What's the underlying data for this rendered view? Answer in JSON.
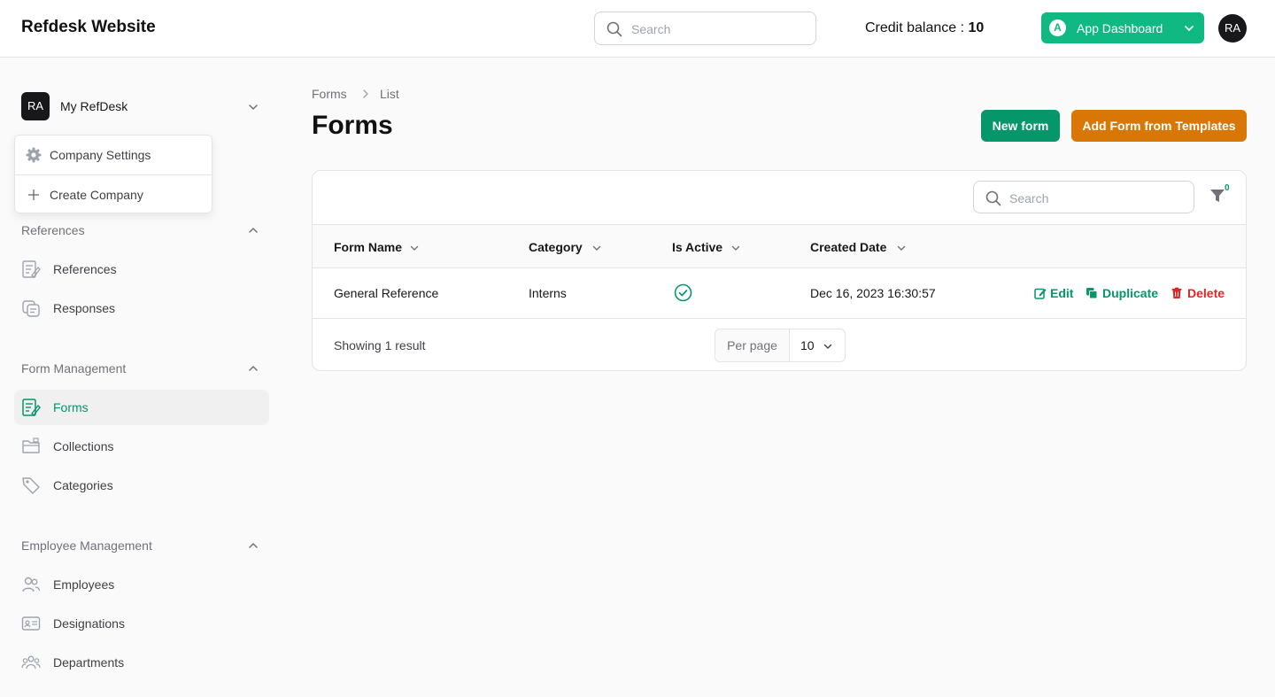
{
  "app": {
    "title": "Refdesk Website"
  },
  "topbar": {
    "search_placeholder": "Search",
    "credit_label": "Credit balance : ",
    "credit_value": "10",
    "app_dashboard": {
      "badge": "A",
      "label": "App Dashboard"
    },
    "user_initials": "RA"
  },
  "sidebar": {
    "company": {
      "initials": "RA",
      "name": "My RefDesk"
    },
    "company_menu": [
      {
        "label": "Company Settings",
        "icon": "gear-icon"
      },
      {
        "label": "Create Company",
        "icon": "plus-icon"
      }
    ],
    "groups": [
      {
        "title": "References",
        "items": [
          {
            "label": "References",
            "icon": "document-pen-icon"
          },
          {
            "label": "Responses",
            "icon": "responses-icon"
          }
        ]
      },
      {
        "title": "Form Management",
        "items": [
          {
            "label": "Forms",
            "icon": "document-pen-icon",
            "active": true
          },
          {
            "label": "Collections",
            "icon": "folder-icon"
          },
          {
            "label": "Categories",
            "icon": "tag-icon"
          }
        ]
      },
      {
        "title": "Employee Management",
        "items": [
          {
            "label": "Employees",
            "icon": "users-icon"
          },
          {
            "label": "Designations",
            "icon": "id-card-icon"
          },
          {
            "label": "Departments",
            "icon": "user-group-icon"
          }
        ]
      }
    ]
  },
  "main": {
    "breadcrumb": [
      "Forms",
      "List"
    ],
    "title": "Forms",
    "actions": {
      "new_form": "New form",
      "add_from_templates": "Add Form from Templates"
    },
    "table": {
      "search_placeholder": "Search",
      "filter_count": "0",
      "columns": [
        "Form Name",
        "Category",
        "Is Active",
        "Created Date"
      ],
      "rows": [
        {
          "form_name": "General Reference",
          "category": "Interns",
          "is_active": true,
          "created_date": "Dec 16, 2023 16:30:57"
        }
      ],
      "row_actions": {
        "edit": "Edit",
        "duplicate": "Duplicate",
        "delete": "Delete"
      },
      "footer": {
        "result_text": "Showing 1 result",
        "per_page_label": "Per page",
        "per_page_value": "10"
      }
    }
  },
  "colors": {
    "primary_green": "#059669",
    "dashboard_green": "#10b981",
    "template_orange": "#d97706",
    "danger_red": "#dc2626"
  }
}
